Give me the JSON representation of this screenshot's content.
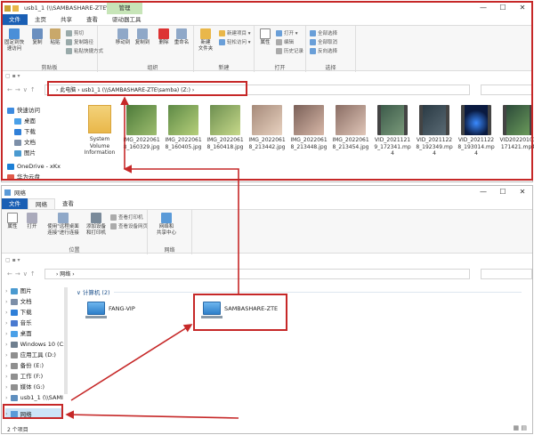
{
  "win1": {
    "title": "usb1_1 (\\\\SAMBASHARE-ZTE\\s...",
    "manage_tab": "管理",
    "tabs": [
      "文件",
      "主页",
      "共享",
      "查看",
      "驱动器工具"
    ],
    "ribbon": {
      "clipboard": {
        "label": "剪贴板",
        "pin": "固定到快\n速访问",
        "copy": "复制",
        "paste": "粘贴",
        "cut": "剪切",
        "copy_path": "复制路径",
        "paste_shortcut": "粘贴快捷方式"
      },
      "organize": {
        "label": "组织",
        "move_to": "移动到",
        "copy_to": "复制到",
        "delete": "删除",
        "rename": "重命名"
      },
      "new": {
        "label": "新建",
        "new_folder": "新建\n文件夹",
        "new_item": "新建项目 ▾",
        "easy_access": "轻松访问 ▾"
      },
      "open": {
        "label": "打开",
        "properties": "属性",
        "open": "打开 ▾",
        "edit": "编辑",
        "history": "历史记录"
      },
      "select": {
        "label": "选择",
        "select_all": "全部选择",
        "select_none": "全部取消",
        "invert": "反向选择"
      }
    },
    "address": "› 此电脑 › usb1_1 (\\\\SAMBASHARE-ZTE\\samba) (Z:) ›",
    "nav": [
      {
        "label": "快速访问",
        "icon": "star-icon",
        "color": "#3d8be0"
      },
      {
        "label": "桌面",
        "icon": "desktop-icon",
        "color": "#4aa0e8"
      },
      {
        "label": "下载",
        "icon": "download-icon",
        "color": "#2f7fd8"
      },
      {
        "label": "文档",
        "icon": "document-icon",
        "color": "#7d8fa8"
      },
      {
        "label": "图片",
        "icon": "picture-icon",
        "color": "#4a9ad0"
      },
      {
        "label": "OneDrive - xKx",
        "icon": "onedrive-icon",
        "color": "#1c7fd6"
      },
      {
        "label": "华为云盘",
        "icon": "cloud-icon",
        "color": "#e05a4a"
      }
    ],
    "files": [
      {
        "name": "System Volume Information",
        "kind": "folder"
      },
      {
        "name": "IMG_20220618_160329.jpg",
        "kind": "image",
        "color": "#4d7a3a"
      },
      {
        "name": "IMG_20220618_160405.jpg",
        "kind": "image",
        "color": "#5e8a46"
      },
      {
        "name": "IMG_20220618_160418.jpg",
        "kind": "image",
        "color": "#6d8f50"
      },
      {
        "name": "IMG_20220618_213442.jpg",
        "kind": "image",
        "color": "#a68a7a"
      },
      {
        "name": "IMG_20220618_213448.jpg",
        "kind": "image",
        "color": "#7a6058"
      },
      {
        "name": "IMG_20220618_213454.jpg",
        "kind": "image",
        "color": "#8a6d64"
      },
      {
        "name": "VID_20211219_172341.mp4",
        "kind": "video",
        "color": "#3c5a4a"
      },
      {
        "name": "VID_20211228_192349.mp4",
        "kind": "video",
        "color": "#2a3a44"
      },
      {
        "name": "VID_20211228_193014.mp4",
        "kind": "video",
        "color": "#1a2a50"
      },
      {
        "name": "VID20220103171421.mp4",
        "kind": "video",
        "color": "#2c4a3a"
      }
    ]
  },
  "win2": {
    "title": "网络",
    "tabs": [
      "文件",
      "网络",
      "查看"
    ],
    "ribbon": {
      "location": {
        "label": "位置",
        "properties": "属性",
        "open": "打开",
        "remote_desktop": "使用\"远程桌面\n连接\"进行连接",
        "add_device": "添加设备\n和打印机",
        "view_printers": "查看打印机",
        "view_device_page": "查看设备网页",
        "network_center": "网络和\n共享中心"
      },
      "network_label": "网络"
    },
    "address": "› 网络 ›",
    "nav": [
      {
        "label": "图片",
        "icon": "picture-icon",
        "color": "#4a9ad0"
      },
      {
        "label": "文档",
        "icon": "document-icon",
        "color": "#7d8fa8"
      },
      {
        "label": "下载",
        "icon": "download-icon",
        "color": "#2f7fd8"
      },
      {
        "label": "音乐",
        "icon": "music-icon",
        "color": "#4a7ad0"
      },
      {
        "label": "桌面",
        "icon": "desktop-icon",
        "color": "#4aa0e8"
      },
      {
        "label": "Windows 10 (C:",
        "icon": "drive-icon",
        "color": "#6f7f8f"
      },
      {
        "label": "应用工具 (D:)",
        "icon": "drive-icon",
        "color": "#8f8f8f"
      },
      {
        "label": "备份 (E:)",
        "icon": "drive-icon",
        "color": "#8f8f8f"
      },
      {
        "label": "工作 (F:)",
        "icon": "drive-icon",
        "color": "#8f8f8f"
      },
      {
        "label": "媒体 (G:)",
        "icon": "drive-icon",
        "color": "#8f8f8f"
      },
      {
        "label": "usb1_1 (\\\\SAMI",
        "icon": "network-drive-icon",
        "color": "#5f8fbf"
      }
    ],
    "nav_network": "网络",
    "group_header": "∨ 计算机 (2)",
    "computers": [
      "FANG-VIP",
      "SAMBASHARE-ZTE"
    ],
    "status": "2 个项目"
  },
  "colors": {
    "annotation_red": "#c62828",
    "file_tab_blue": "#1a5fb4",
    "manage_tab_green": "#c7e5b8"
  }
}
